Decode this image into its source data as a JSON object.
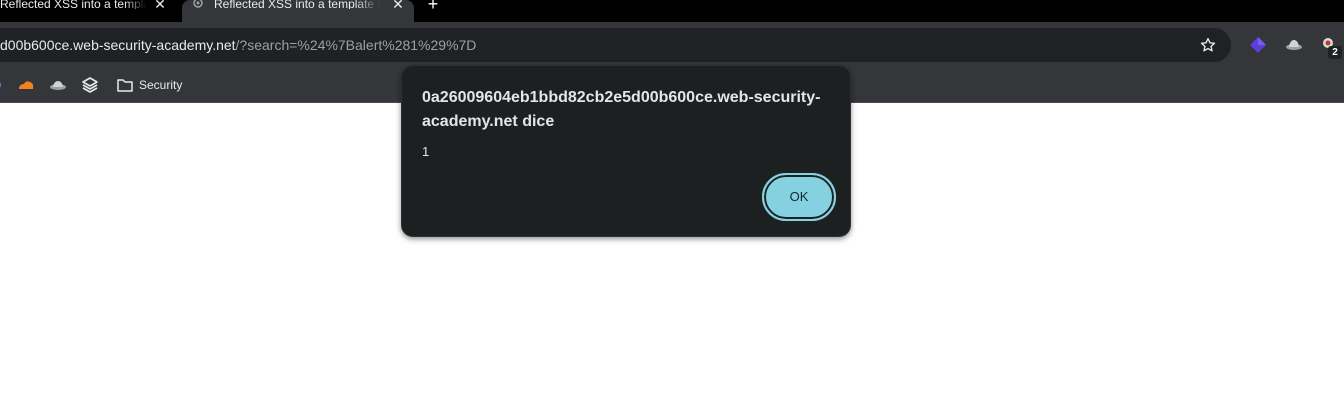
{
  "tabs": [
    {
      "title": "Reflected XSS into a template literal"
    },
    {
      "title": "Reflected XSS into a template literal"
    }
  ],
  "omnibox": {
    "host": "d00b600ce.web-security-academy.net",
    "path": "/?search=%24%7Balert%281%29%7D"
  },
  "toolbar": {
    "extension_badge": "2"
  },
  "bookmarks": {
    "folder_label": "Security"
  },
  "dialog": {
    "title": "0a26009604eb1bbd82cb2e5d00b600ce.web-security-academy.net dice",
    "message": "1",
    "ok_label": "OK"
  },
  "colors": {
    "dialog_bg": "#1c2021",
    "ok_accent": "#85d1e0",
    "toolbar_bg": "#35363a",
    "tabstrip_bg": "#000000"
  },
  "icons": [
    "close-icon",
    "new-tab-icon",
    "star-icon",
    "extension-icon",
    "folder-icon",
    "cloudflare-icon",
    "burp-icon",
    "stack-icon"
  ]
}
